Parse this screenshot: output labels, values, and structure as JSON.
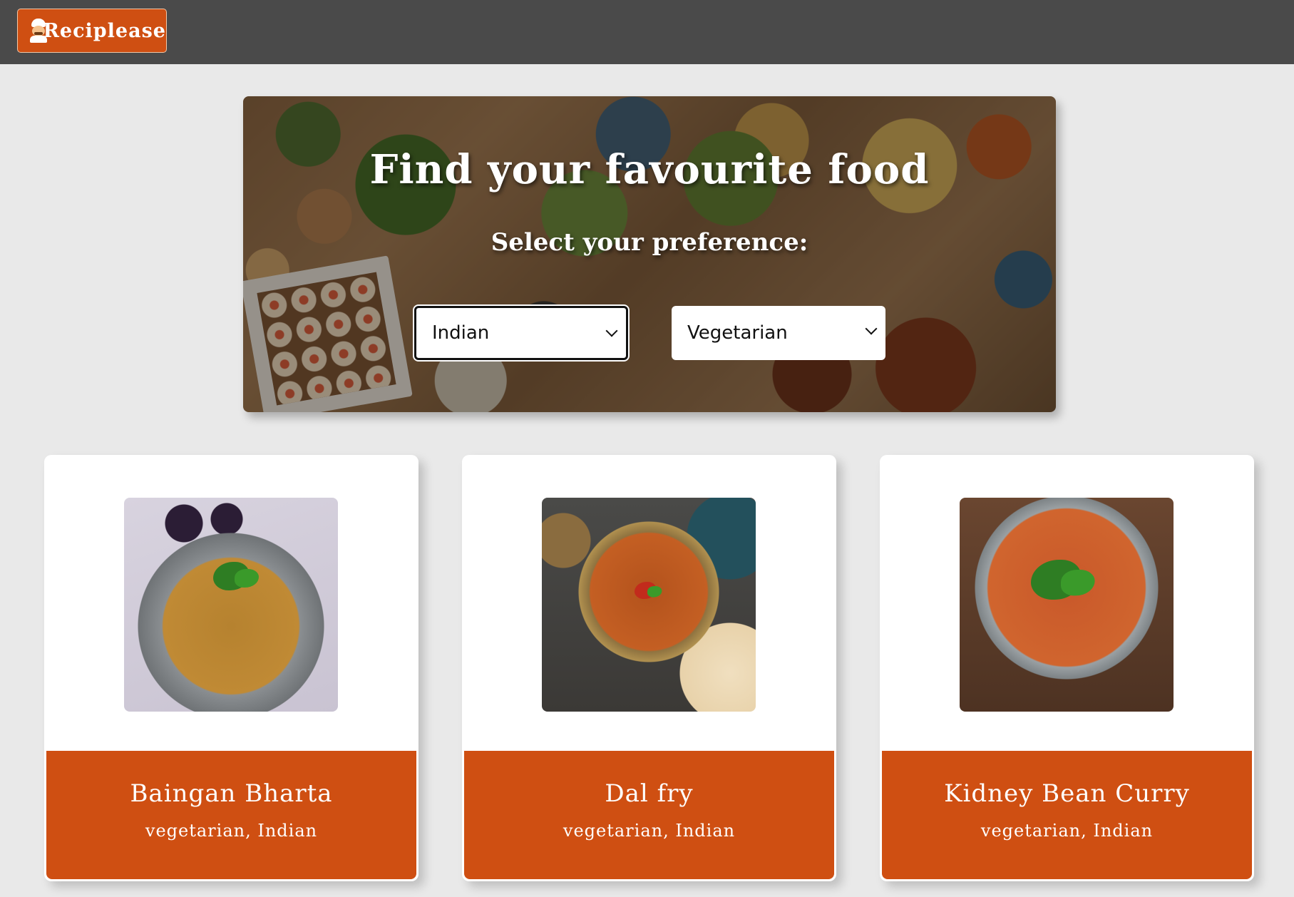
{
  "navbar": {
    "brand_label": "Reciplease",
    "brand_icon": "chef-icon"
  },
  "hero": {
    "title": "Find your favourite food",
    "subtitle": "Select your preference:",
    "cuisine_select": {
      "value": "Indian",
      "icon": "chevron-down-icon"
    },
    "diet_select": {
      "value": "Vegetarian",
      "icon": "chevron-down-icon"
    }
  },
  "colors": {
    "navbar_bg": "#4a4a4a",
    "accent": "#cf4f12",
    "page_bg": "#e9e9e9"
  },
  "recipes": [
    {
      "title": "Baingan Bharta",
      "tags": "vegetarian, Indian",
      "image": "baingan-bharta-photo"
    },
    {
      "title": "Dal fry",
      "tags": "vegetarian, Indian",
      "image": "dal-fry-photo"
    },
    {
      "title": "Kidney Bean Curry",
      "tags": "vegetarian, Indian",
      "image": "kidney-bean-curry-photo"
    }
  ]
}
